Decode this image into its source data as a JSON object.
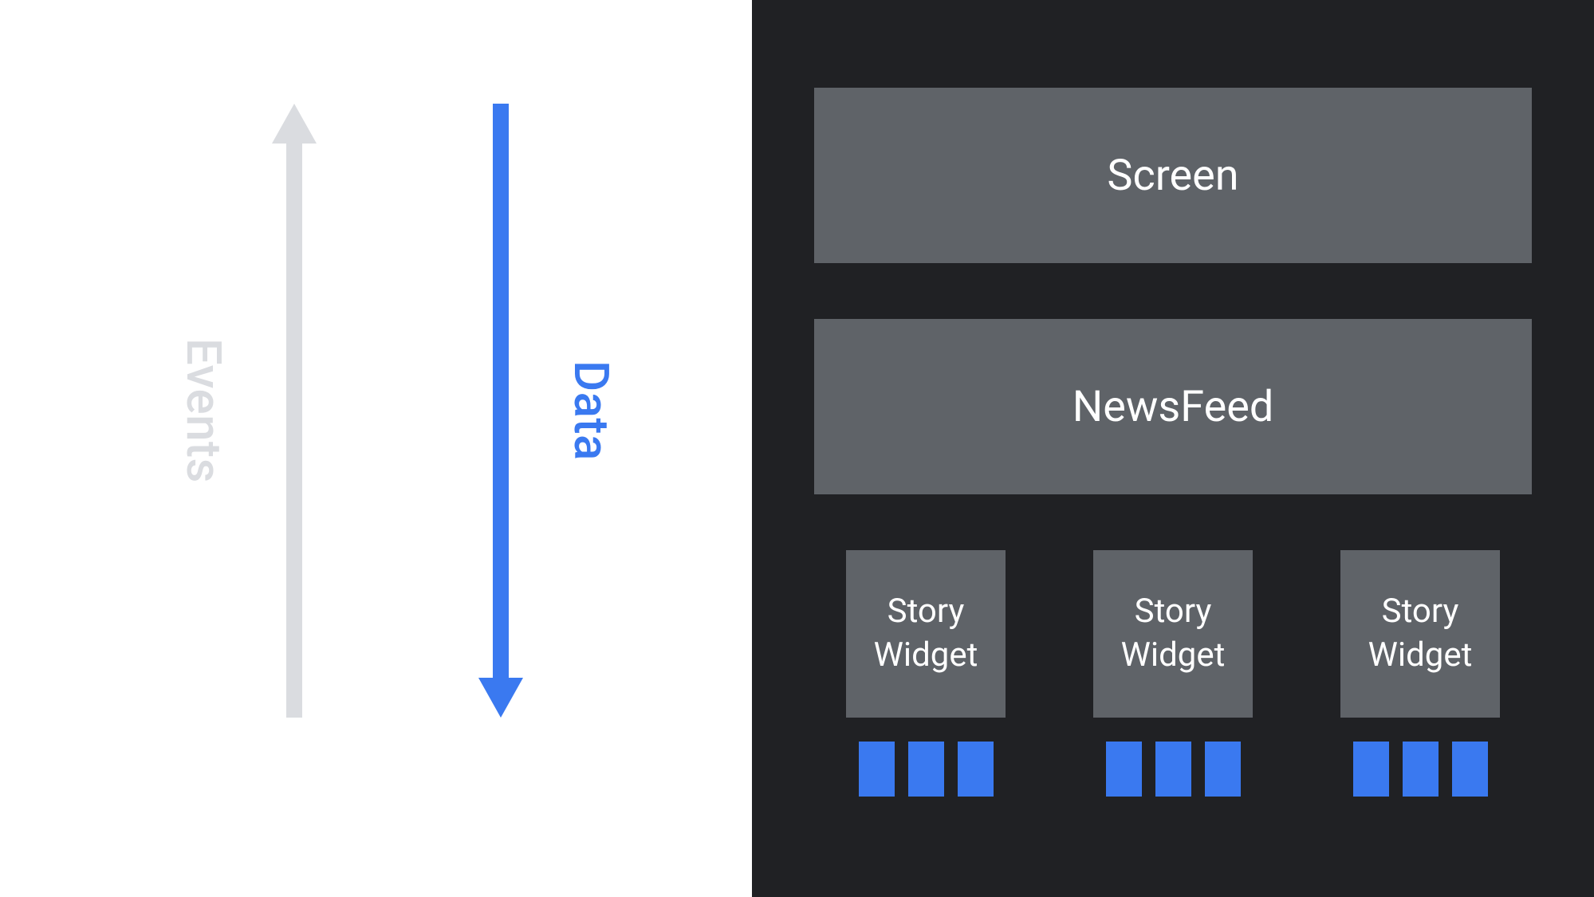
{
  "left_panel": {
    "events_label": "Events",
    "data_label": "Data"
  },
  "right_panel": {
    "screen_label": "Screen",
    "newsfeed_label": "NewsFeed",
    "widgets": [
      {
        "label": "Story\nWidget",
        "pip_count": 3
      },
      {
        "label": "Story\nWidget",
        "pip_count": 3
      },
      {
        "label": "Story\nWidget",
        "pip_count": 3
      }
    ]
  },
  "colors": {
    "events_arrow": "#dadce0",
    "data_arrow": "#3a79f0",
    "box_bg": "#5f6368",
    "pip": "#3a79f0",
    "dark_bg": "#202124"
  }
}
